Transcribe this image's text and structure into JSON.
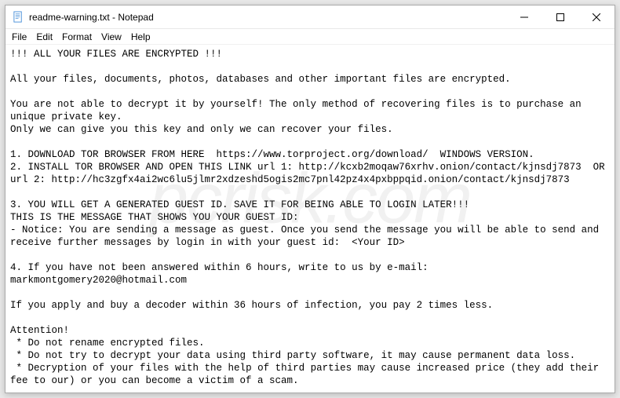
{
  "window": {
    "title": "readme-warning.txt - Notepad"
  },
  "menu": {
    "file": "File",
    "edit": "Edit",
    "format": "Format",
    "view": "View",
    "help": "Help"
  },
  "body": {
    "text": "!!! ALL YOUR FILES ARE ENCRYPTED !!!\n\nAll your files, documents, photos, databases and other important files are encrypted.\n\nYou are not able to decrypt it by yourself! The only method of recovering files is to purchase an unique private key.\nOnly we can give you this key and only we can recover your files.\n\n1. DOWNLOAD TOR BROWSER FROM HERE  https://www.torproject.org/download/  WINDOWS VERSION.\n2. INSTALL TOR BROWSER AND OPEN THIS LINK url 1: http://kcxb2moqaw76xrhv.onion/contact/kjnsdj7873  OR url 2: http://hc3zgfx4ai2wc6lu5jlmr2xdzeshd5ogis2mc7pnl42pz4x4pxbppqid.onion/contact/kjnsdj7873\n\n3. YOU WILL GET A GENERATED GUEST ID. SAVE IT FOR BEING ABLE TO LOGIN LATER!!!\nTHIS IS THE MESSAGE THAT SHOWS YOU YOUR GUEST ID:\n- Notice: You are sending a message as guest. Once you send the message you will be able to send and receive further messages by login in with your guest id:  <Your ID>\n\n4. If you have not been answered within 6 hours, write to us by e-mail: markmontgomery2020@hotmail.com\n\nIf you apply and buy a decoder within 36 hours of infection, you pay 2 times less.\n\nAttention!\n * Do not rename encrypted files.\n * Do not try to decrypt your data using third party software, it may cause permanent data loss.\n * Decryption of your files with the help of third parties may cause increased price (they add their fee to our) or you can become a victim of a scam."
  },
  "watermark": "pcrisk.com"
}
